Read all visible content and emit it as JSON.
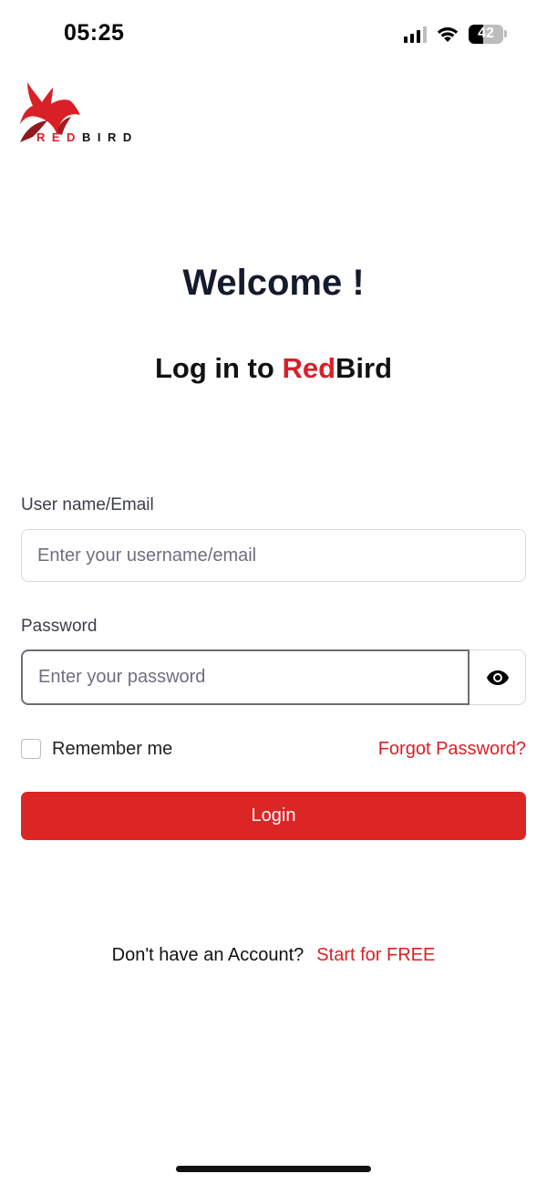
{
  "status_bar": {
    "time": "05:25",
    "battery_percent": "42",
    "battery_level": 0.42,
    "icons": [
      "cellular-signal-icon",
      "wifi-icon",
      "battery-icon"
    ]
  },
  "logo": {
    "word_red": "RED",
    "word_black": "BIRD",
    "icon": "redbird-logo-icon"
  },
  "header": {
    "welcome": "Welcome !",
    "subtitle_prefix": "Log in to ",
    "subtitle_brand_red": "Red",
    "subtitle_brand_black": "Bird"
  },
  "form": {
    "username_label": "User name/Email",
    "username_placeholder": "Enter your username/email",
    "username_value": "",
    "password_label": "Password",
    "password_placeholder": "Enter your password",
    "password_value": "",
    "show_password_icon": "eye-icon",
    "remember_label": "Remember me",
    "remember_checked": false,
    "forgot_link": "Forgot Password?",
    "login_button": "Login"
  },
  "footer": {
    "no_account_text": "Don't have an Account?",
    "signup_link": "Start for FREE"
  },
  "colors": {
    "brand_red": "#dc2626",
    "heading_dark": "#151b2e",
    "input_border": "#d4d7dc"
  }
}
